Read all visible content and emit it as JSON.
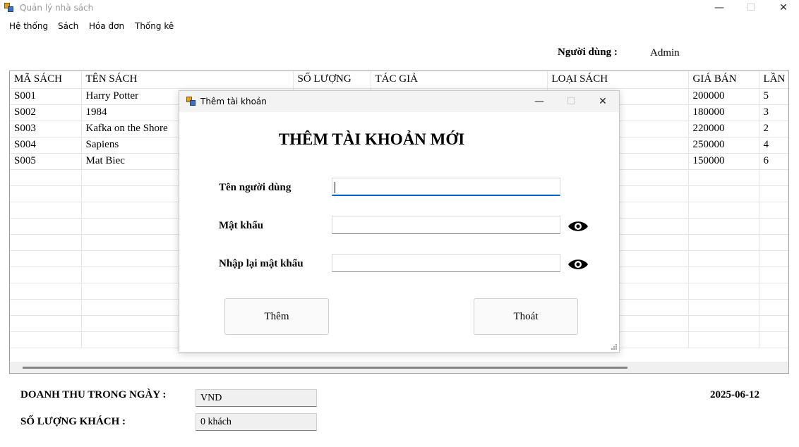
{
  "window": {
    "title": "Quản lý nhà sách",
    "minimize": "—",
    "maximize": "☐",
    "close": "✕"
  },
  "menu": [
    "Hệ thống",
    "Sách",
    "Hóa đơn",
    "Thống kê"
  ],
  "user": {
    "label": "Người dùng :",
    "value": "Admin"
  },
  "table": {
    "columns": [
      "MÃ SÁCH",
      "TÊN SÁCH",
      "SỐ LƯỢNG",
      "TÁC GIẢ",
      "LOẠI SÁCH",
      "GIÁ BÁN",
      "LẦN"
    ],
    "rows": [
      [
        "S001",
        "Harry Potter",
        "",
        "",
        "",
        "200000",
        "5"
      ],
      [
        "S002",
        "1984",
        "",
        "",
        "",
        "180000",
        "3"
      ],
      [
        "S003",
        "Kafka on the Shore",
        "",
        "",
        "",
        "220000",
        "2"
      ],
      [
        "S004",
        "Sapiens",
        "",
        "",
        "",
        "250000",
        "4"
      ],
      [
        "S005",
        "Mat Biec",
        "",
        "",
        "",
        "150000",
        "6"
      ]
    ]
  },
  "footer": {
    "revenue_label": "DOANH THU TRONG NGÀY :",
    "revenue_value": "VND",
    "customers_label": "SỐ LƯỢNG KHÁCH :",
    "customers_value": "0 khách",
    "date": "2025-06-12"
  },
  "dialog": {
    "title": "Thêm tài khoản",
    "heading": "THÊM TÀI KHOẢN MỚI",
    "username_label": "Tên người dùng",
    "username_value": "",
    "password_label": "Mật khẩu",
    "password_value": "",
    "confirm_label": "Nhập lại mật khẩu",
    "confirm_value": "",
    "add_button": "Thêm",
    "exit_button": "Thoát",
    "minimize": "—",
    "maximize": "☐",
    "close": "✕"
  },
  "icons": {
    "app": "app-icon",
    "eye": "eye-icon"
  },
  "colors": {
    "focus_accent": "#0067c0",
    "window_bg": "#ffffff",
    "dialog_titlebar": "#f3f3f3",
    "readonly_box": "#f0f0f0"
  }
}
